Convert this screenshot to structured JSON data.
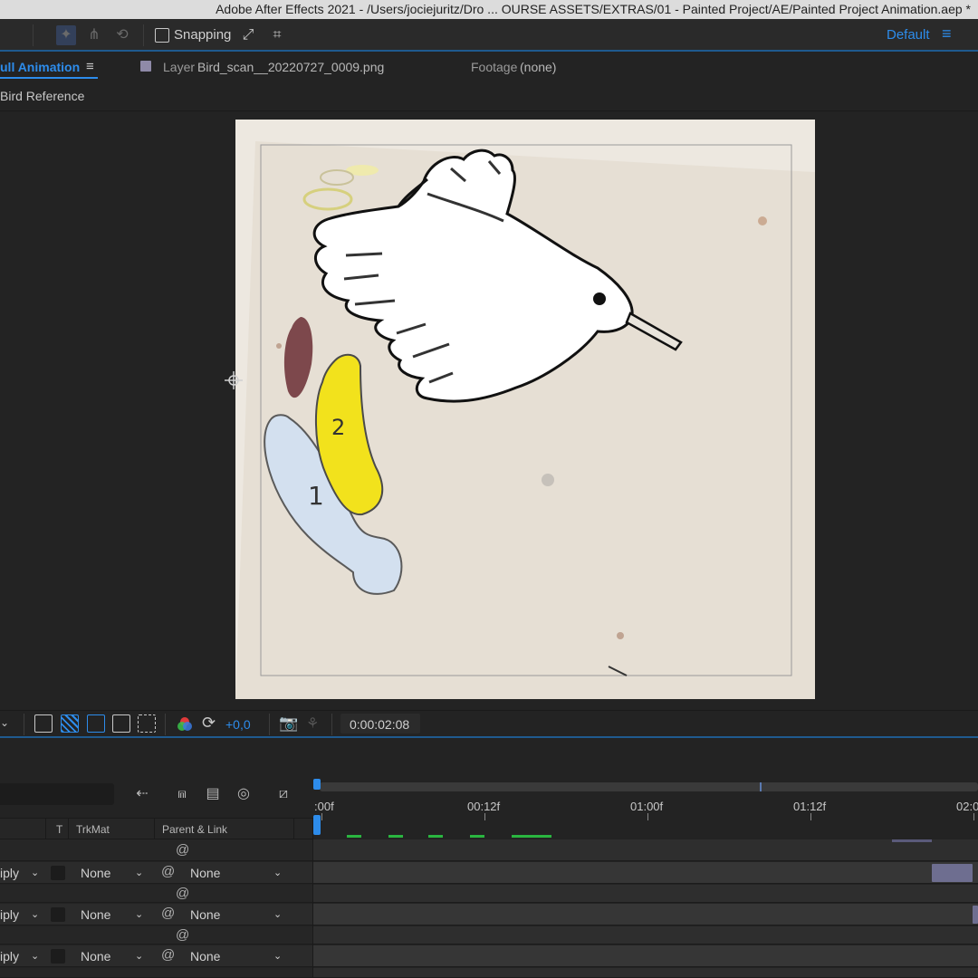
{
  "window": {
    "title": "Adobe After Effects 2021 - /Users/jociejuritz/Dro ... OURSE ASSETS/EXTRAS/01 - Painted Project/AE/Painted Project Animation.aep *"
  },
  "toolbar": {
    "snapping_label": "Snapping",
    "workspace_label": "Default"
  },
  "panels": {
    "composition_tab": "ull Animation",
    "layer_tab_prefix": "Layer",
    "layer_tab_name": "Bird_scan__20220727_0009.png",
    "footage_tab_prefix": "Footage",
    "footage_tab_value": "(none)",
    "breadcrumb": "Bird Reference"
  },
  "viewer_controls": {
    "exposure": "+0,0",
    "timecode": "0:00:02:08"
  },
  "timeline": {
    "ruler_labels": [
      ":00f",
      "00:12f",
      "01:00f",
      "01:12f",
      "02:0"
    ],
    "columns": {
      "t": "T",
      "trkmat": "TrkMat",
      "parent": "Parent & Link"
    },
    "rows": [
      {
        "mode": "iply",
        "trkmat": "None",
        "parent": "None"
      },
      {
        "mode": "iply",
        "trkmat": "None",
        "parent": "None"
      },
      {
        "mode": "iply",
        "trkmat": "None",
        "parent": "None"
      }
    ]
  },
  "artwork": {
    "numbers": [
      "1",
      "2"
    ]
  },
  "colors": {
    "accent": "#2d8ceb",
    "keyframe_green": "#2ab540",
    "layer_bar": "#6e6e90",
    "paper": "#ede8e0",
    "yellow_paint": "#f2e21c",
    "blue_paint": "#d3e0ef"
  }
}
